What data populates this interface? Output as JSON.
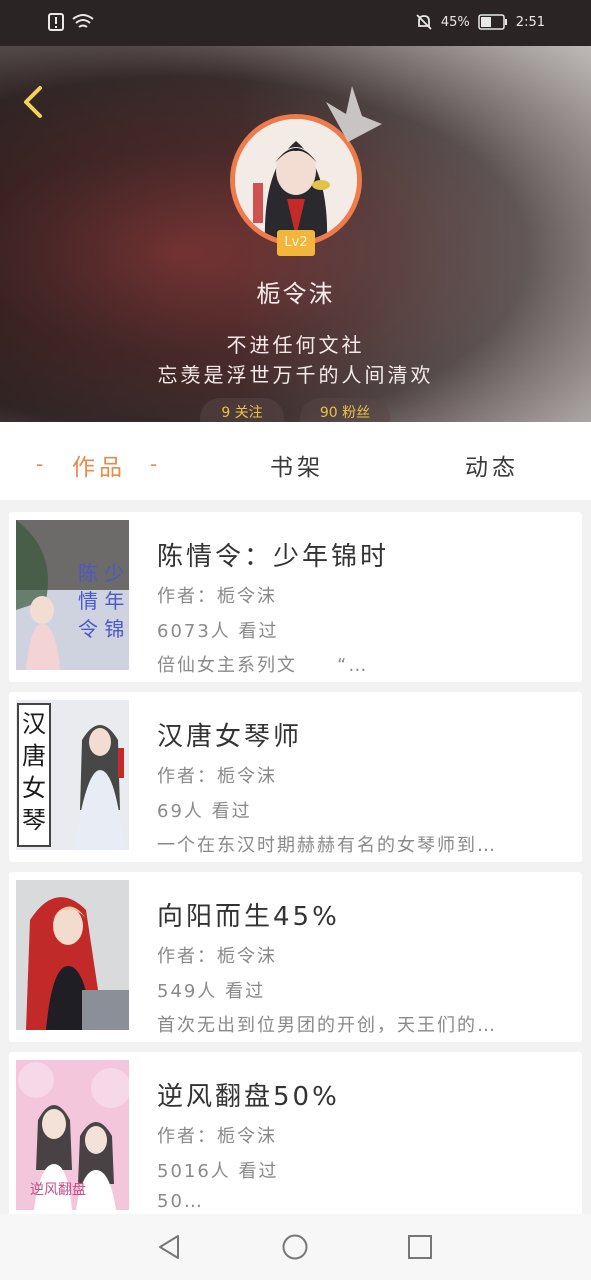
{
  "status_bar": {
    "battery_percent": "45%",
    "time": "2:51",
    "icons": [
      "alert-icon",
      "wifi-icon",
      "mute-bell-icon",
      "battery-icon"
    ]
  },
  "profile": {
    "username": "栀令沫",
    "level": "Lv2",
    "bio_line1": "不进任何文社",
    "bio_line2": "忘羡是浮世万千的人间清欢",
    "following_label": "9 关注",
    "followers_label": "90 粉丝"
  },
  "tabs": [
    {
      "label": "作品",
      "active": true
    },
    {
      "label": "书架",
      "active": false
    },
    {
      "label": "动态",
      "active": false
    }
  ],
  "works": [
    {
      "title": "陈情令：少年锦时",
      "author": "作者：栀令沫",
      "views": "6073人 看过",
      "summary": "倍仙女主系列文　　“…"
    },
    {
      "title": "汉唐女琴师",
      "author": "作者：栀令沫",
      "views": "69人 看过",
      "summary": "一个在东汉时期赫赫有名的女琴师到…"
    },
    {
      "title": "向阳而生45%",
      "author": "作者：栀令沫",
      "views": "549人 看过",
      "summary": "首次无出到位男团的开创，天王们的…"
    },
    {
      "title": "逆风翻盘50%",
      "author": "作者：栀令沫",
      "views": "5016人 看过",
      "summary": "50…"
    }
  ],
  "colors": {
    "accent": "#e98a4e",
    "level_badge": "#f2b63a",
    "avatar_ring": "#f07b4a"
  }
}
